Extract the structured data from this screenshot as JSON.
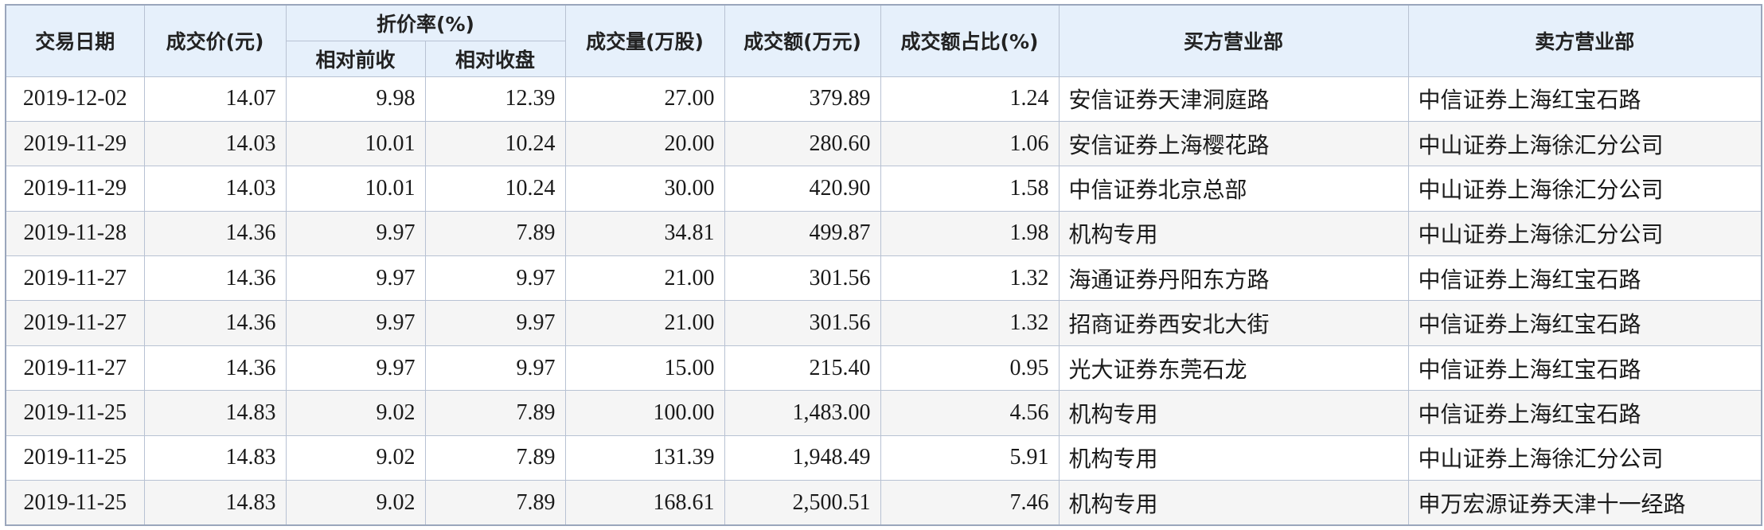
{
  "table": {
    "headers": {
      "date": "交易日期",
      "price": "成交价(元)",
      "discount": "折价率(%)",
      "discount_prev_close": "相对前收",
      "discount_close": "相对收盘",
      "volume": "成交量(万股)",
      "amount": "成交额(万元)",
      "ratio": "成交额占比(%)",
      "buyer": "买方营业部",
      "seller": "卖方营业部"
    },
    "rows": [
      {
        "date": "2019-12-02",
        "price": "14.07",
        "rel_prev": "9.98",
        "rel_close": "12.39",
        "volume": "27.00",
        "amount": "379.89",
        "ratio": "1.24",
        "buyer": "安信证券天津洞庭路",
        "seller": "中信证券上海红宝石路"
      },
      {
        "date": "2019-11-29",
        "price": "14.03",
        "rel_prev": "10.01",
        "rel_close": "10.24",
        "volume": "20.00",
        "amount": "280.60",
        "ratio": "1.06",
        "buyer": "安信证券上海樱花路",
        "seller": "中山证券上海徐汇分公司"
      },
      {
        "date": "2019-11-29",
        "price": "14.03",
        "rel_prev": "10.01",
        "rel_close": "10.24",
        "volume": "30.00",
        "amount": "420.90",
        "ratio": "1.58",
        "buyer": "中信证券北京总部",
        "seller": "中山证券上海徐汇分公司"
      },
      {
        "date": "2019-11-28",
        "price": "14.36",
        "rel_prev": "9.97",
        "rel_close": "7.89",
        "volume": "34.81",
        "amount": "499.87",
        "ratio": "1.98",
        "buyer": "机构专用",
        "seller": "中山证券上海徐汇分公司"
      },
      {
        "date": "2019-11-27",
        "price": "14.36",
        "rel_prev": "9.97",
        "rel_close": "9.97",
        "volume": "21.00",
        "amount": "301.56",
        "ratio": "1.32",
        "buyer": "海通证券丹阳东方路",
        "seller": "中信证券上海红宝石路"
      },
      {
        "date": "2019-11-27",
        "price": "14.36",
        "rel_prev": "9.97",
        "rel_close": "9.97",
        "volume": "21.00",
        "amount": "301.56",
        "ratio": "1.32",
        "buyer": "招商证券西安北大街",
        "seller": "中信证券上海红宝石路"
      },
      {
        "date": "2019-11-27",
        "price": "14.36",
        "rel_prev": "9.97",
        "rel_close": "9.97",
        "volume": "15.00",
        "amount": "215.40",
        "ratio": "0.95",
        "buyer": "光大证券东莞石龙",
        "seller": "中信证券上海红宝石路"
      },
      {
        "date": "2019-11-25",
        "price": "14.83",
        "rel_prev": "9.02",
        "rel_close": "7.89",
        "volume": "100.00",
        "amount": "1,483.00",
        "ratio": "4.56",
        "buyer": "机构专用",
        "seller": "中信证券上海红宝石路"
      },
      {
        "date": "2019-11-25",
        "price": "14.83",
        "rel_prev": "9.02",
        "rel_close": "7.89",
        "volume": "131.39",
        "amount": "1,948.49",
        "ratio": "5.91",
        "buyer": "机构专用",
        "seller": "中山证券上海徐汇分公司"
      },
      {
        "date": "2019-11-25",
        "price": "14.83",
        "rel_prev": "9.02",
        "rel_close": "7.89",
        "volume": "168.61",
        "amount": "2,500.51",
        "ratio": "7.46",
        "buyer": "机构专用",
        "seller": "申万宏源证券天津十一经路"
      }
    ]
  }
}
